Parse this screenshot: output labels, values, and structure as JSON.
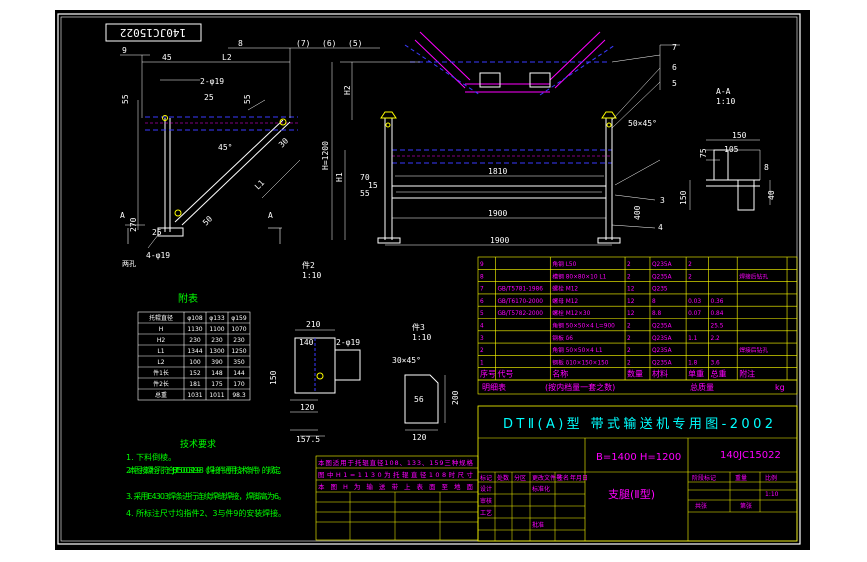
{
  "drawing_number": "140JC15022",
  "title_main": "DTⅡ(A)型 带式输送机专用图-2002",
  "spec": "B=1400 H=1200",
  "part_name": "支腿(Ⅱ型)",
  "section_label": "A-A",
  "section_scale": "1:10",
  "detail2_label": "件2",
  "detail2_scale": "1:10",
  "detail3_label": "件3",
  "detail3_scale": "1:10",
  "table_title": "附表",
  "table_headers": [
    "托辊直径",
    "φ108",
    "φ133",
    "φ159"
  ],
  "table_rows": [
    [
      "H",
      "1130",
      "1100",
      "1070"
    ],
    [
      "H2",
      "230",
      "230",
      "230"
    ],
    [
      "L1",
      "1344",
      "1300",
      "1250"
    ],
    [
      "L2",
      "100",
      "390",
      "350"
    ],
    [
      "件1长",
      "152",
      "148",
      "144"
    ],
    [
      "件2长",
      "181",
      "175",
      "170"
    ],
    [
      "总重",
      "1031",
      "1011",
      "98.3"
    ]
  ],
  "bom_header": [
    "序号",
    "代号",
    "名称",
    "数量",
    "材料",
    "单重",
    "总重",
    "附注"
  ],
  "bom_rows": [
    [
      "9",
      "",
      "角钢 L50",
      "2",
      "Q235A",
      "2",
      "",
      ""
    ],
    [
      "8",
      "",
      "槽钢 80×80×10 L1",
      "2",
      "Q235A",
      "2",
      "",
      "焊接后钻孔"
    ],
    [
      "7",
      "GB/T5781-1986",
      "螺栓 M12",
      "12",
      "Q235",
      "",
      "",
      ""
    ],
    [
      "6",
      "GB/T6170-2000",
      "螺母 M12",
      "12",
      "8",
      "0.03",
      "0.36",
      ""
    ],
    [
      "5",
      "GB/T5782-2000",
      "螺栓 M12×30",
      "12",
      "8.8",
      "0.07",
      "0.84",
      ""
    ],
    [
      "4",
      "",
      "角钢 50×50×4 L=900",
      "2",
      "Q235A",
      "",
      "25.5",
      ""
    ],
    [
      "3",
      "",
      "钢板 δ6",
      "2",
      "Q235A",
      "1.1",
      "2.2",
      ""
    ],
    [
      "2",
      "",
      "角钢 50×50×4 L1",
      "2",
      "Q235A",
      "",
      "",
      "焊接后钻孔"
    ],
    [
      "1",
      "",
      "钢板 δ10×150×150",
      "2",
      "Q235A",
      "1.8",
      "3.6",
      ""
    ]
  ],
  "bom_footer": [
    "明细表",
    "(按内档量一套之数)",
    "总质量",
    "kg"
  ],
  "title_cells": [
    "标记",
    "处数",
    "分区",
    "更改文件号",
    "签名",
    "年月日",
    "设计",
    "标准化",
    "审核",
    "工艺",
    "批准",
    "阶段标记",
    "重量",
    "比例",
    "1:10",
    "共张",
    "第张"
  ],
  "notes_title": "技术要求",
  "notes": [
    "1. 下料倒棱。",
    "2. 本图按螺栓孔符合JB/T5000.3-1998《焊接件通用技术条件》的规定。",
    "3. 采用E4303焊条进行连续焊缝焊接，焊脚高为6。",
    "4. 所标注尺寸均指件2、3与件9的安装焊接。"
  ],
  "change_notes": [
    "本图适用于托辊直径108、133、159三种规格",
    "图中H1=1130为托辊直径108时尺寸",
    "本图H为输送带上表面至地面"
  ],
  "dims": {
    "d_45": "45",
    "d_L2": "L2",
    "d_8": "8",
    "d_7": "(7)",
    "d_6": "(6)",
    "d_5": "(5)",
    "d_9": "9",
    "d_2phi": "2-φ19",
    "d_25": "25",
    "d_55": "55",
    "d_45deg": "45°",
    "d_L1": "L1",
    "d_50": "50",
    "d_30": "30",
    "d_A": "A",
    "d_270": "270",
    "d_4phi": "4-φ19",
    "d_hole": "两孔",
    "d_1200": "H=1200",
    "d_H1": "H1",
    "d_H2": "H2",
    "d_70": "70",
    "d_55b": "55",
    "d_15": "15",
    "d_1810": "1810",
    "d_1900": "1900",
    "d_1900b": "1900",
    "d_7r": "7",
    "d_6r": "6",
    "d_5r": "5",
    "d_chamfer": "50×45°",
    "d_3": "3",
    "d_4": "4",
    "d_400": "400",
    "d_150": "150",
    "d_105": "105",
    "d_75": "75",
    "d_150b": "150",
    "d_8b": "8",
    "d_40": "40",
    "d_210": "210",
    "d_140": "140",
    "d_150c": "150",
    "d_120": "120",
    "d_157": "157.5",
    "d_2phi19": "2-φ19",
    "d_30x45": "30×45°",
    "d_56": "56",
    "d_200": "200",
    "d_120b": "120"
  },
  "colors": {
    "background": "#000000",
    "frame": "#ffffff",
    "table_lines": "#ffff00",
    "text_green": "#00ff00",
    "text_magenta": "#ff00ff",
    "dim_cyan": "#00ffff",
    "blue": "#3a3aff"
  }
}
